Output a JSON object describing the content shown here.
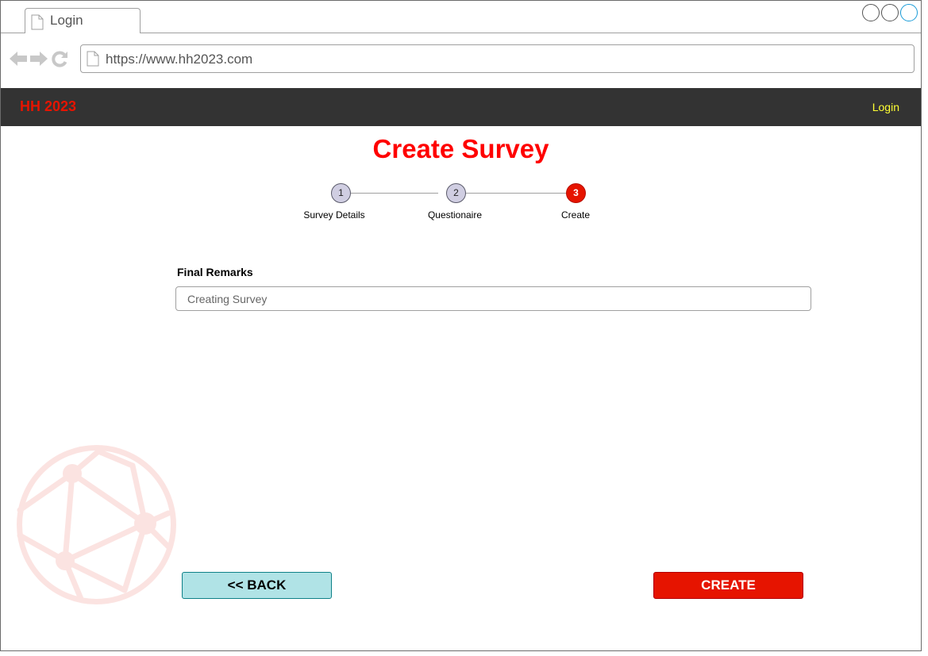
{
  "browser": {
    "tab_title": "Login",
    "url": "https://www.hh2023.com"
  },
  "header": {
    "brand": "HH 2023",
    "login_label": "Login"
  },
  "page": {
    "title": "Create Survey"
  },
  "stepper": {
    "steps": [
      {
        "number": "1",
        "label": "Survey Details",
        "state": "completed"
      },
      {
        "number": "2",
        "label": "Questionaire",
        "state": "completed"
      },
      {
        "number": "3",
        "label": "Create",
        "state": "active"
      }
    ]
  },
  "form": {
    "final_remarks_label": "Final Remarks",
    "final_remarks_placeholder": "Creating Survey"
  },
  "actions": {
    "back_label": "<<  BACK",
    "create_label": "CREATE"
  },
  "colors": {
    "accent_red": "#e61400",
    "header_bg": "#333333",
    "login_link": "#ffff33",
    "back_button_bg": "#b0e3e6",
    "step_inactive_bg": "#d0cee2"
  },
  "icons": {
    "tab": "page-icon",
    "nav": [
      "back-arrow-icon",
      "forward-arrow-icon",
      "reload-icon"
    ],
    "url": "page-icon",
    "watermark": "network-globe-icon"
  }
}
